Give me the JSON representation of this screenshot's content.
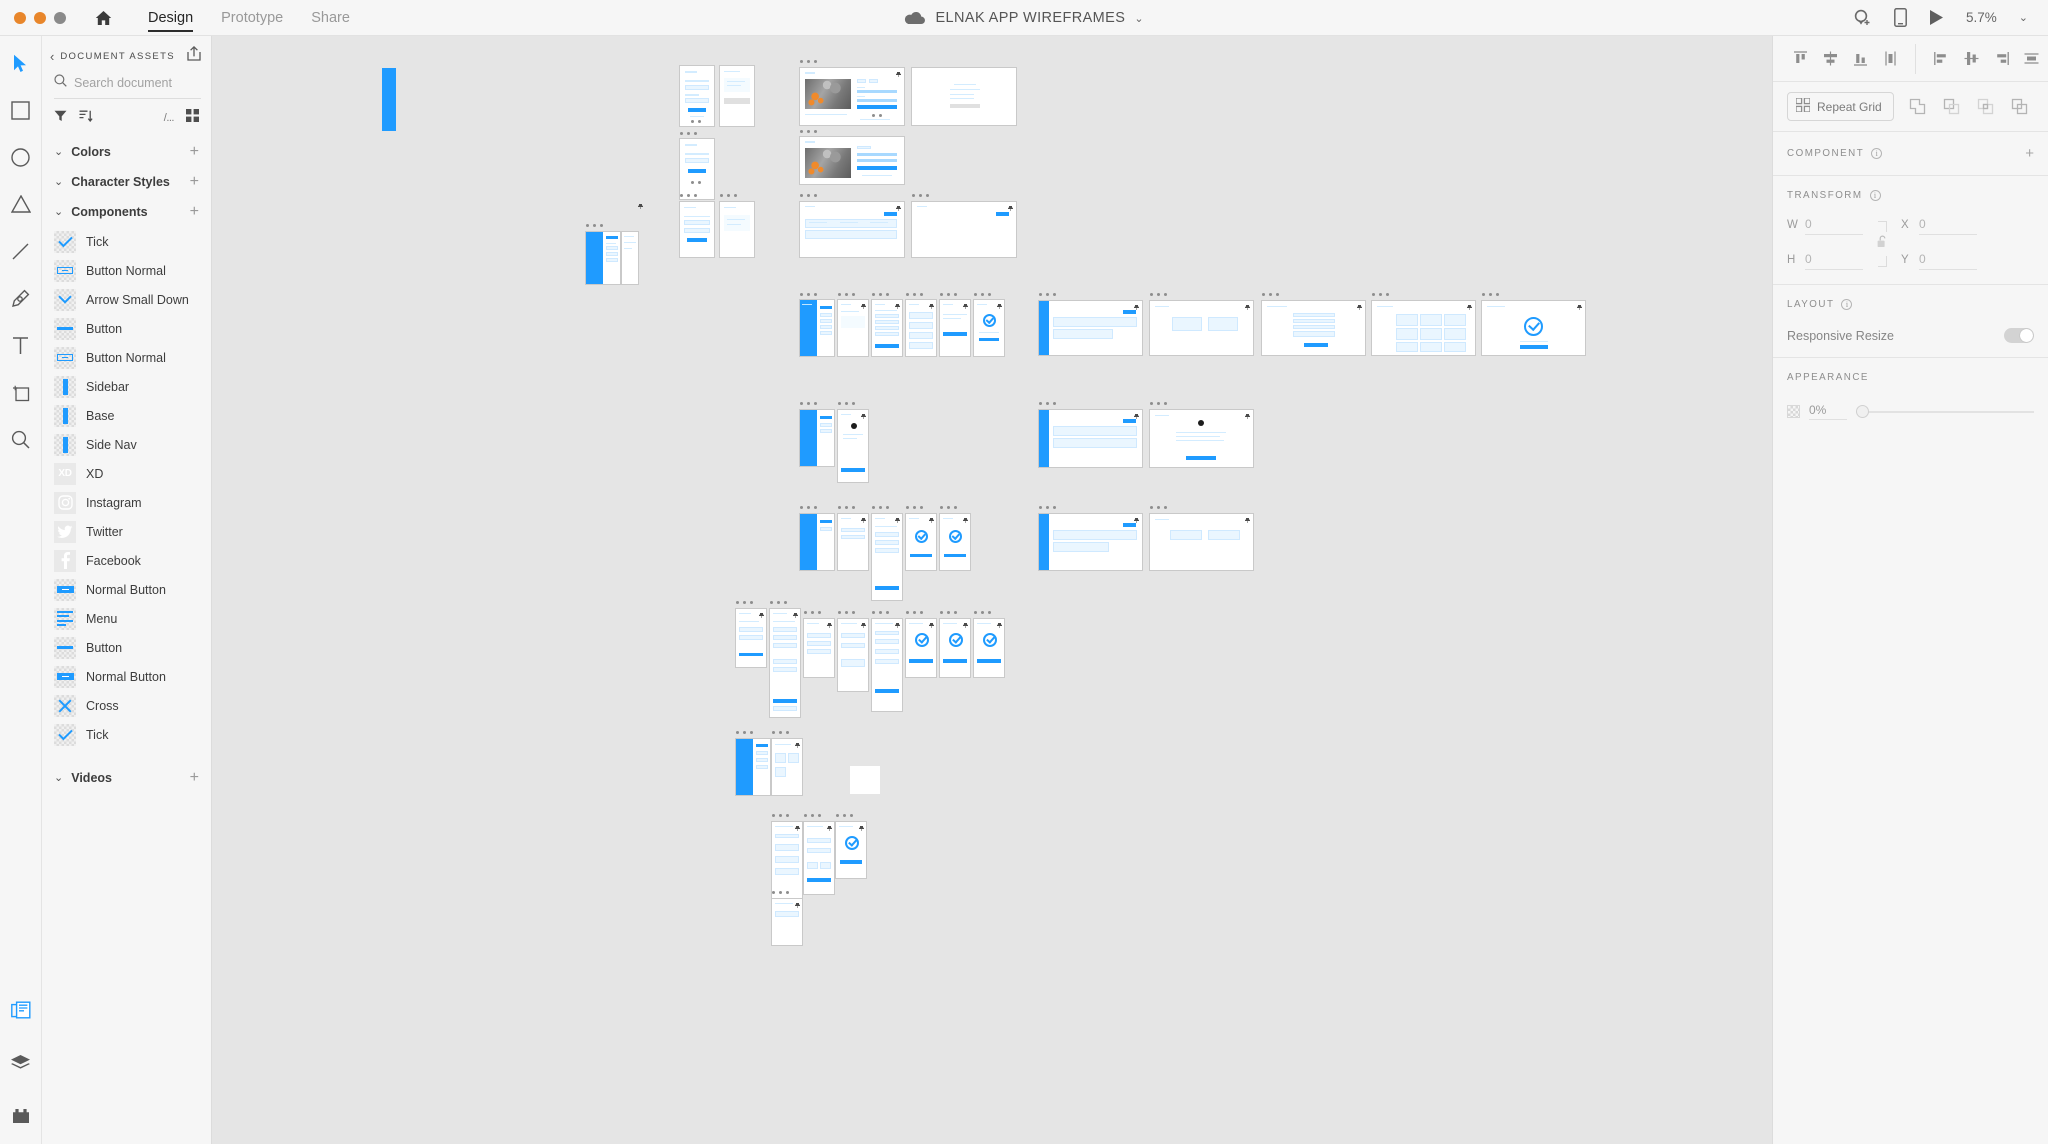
{
  "titlebar": {
    "window_controls": [
      "close",
      "minimize",
      "maximize"
    ],
    "home_icon": "home-icon",
    "tabs": [
      {
        "label": "Design",
        "active": true
      },
      {
        "label": "Prototype",
        "active": false
      },
      {
        "label": "Share",
        "active": false
      }
    ],
    "document_title": "ELNAK APP WIREFRAMES",
    "document_chevron": "⌄",
    "cloud_icon": "cloud-icon",
    "right_icons": [
      "add-collaborator-icon",
      "device-preview-icon",
      "play-preview-icon"
    ],
    "zoom_level": "5.7%",
    "zoom_chevron": "⌄"
  },
  "toolbar": {
    "tools": [
      {
        "name": "select-tool",
        "active": true
      },
      {
        "name": "rectangle-tool",
        "active": false
      },
      {
        "name": "ellipse-tool",
        "active": false
      },
      {
        "name": "polygon-tool",
        "active": false
      },
      {
        "name": "line-tool",
        "active": false
      },
      {
        "name": "pen-tool",
        "active": false
      },
      {
        "name": "text-tool",
        "active": false
      },
      {
        "name": "artboard-tool",
        "active": false
      },
      {
        "name": "zoom-tool",
        "active": false
      }
    ],
    "bottom_tools": [
      {
        "name": "assets-panel-toggle",
        "active": true
      },
      {
        "name": "layers-panel-toggle",
        "active": false
      },
      {
        "name": "plugins-panel-toggle",
        "active": false
      }
    ]
  },
  "assets_panel": {
    "back_chevron": "‹",
    "title": "DOCUMENT ASSETS",
    "publish_icon": "publish-share-icon",
    "search": {
      "placeholder": "Search document",
      "value": ""
    },
    "search_icon": "search-icon",
    "search_chevron": "⌄",
    "filter_icon": "filter-icon",
    "sort_icon": "sort-icon",
    "slash_label": "/...",
    "grid_icon": "grid-view-icon",
    "groups": [
      {
        "label": "Colors",
        "chevron": "⌄",
        "plus": "+",
        "items": []
      },
      {
        "label": "Character Styles",
        "chevron": "⌄",
        "plus": "+",
        "items": []
      },
      {
        "label": "Components",
        "chevron": "⌄",
        "plus": "+",
        "items": [
          {
            "label": "Tick",
            "thumb": "tick-check"
          },
          {
            "label": "Button Normal",
            "thumb": "button-outline"
          },
          {
            "label": "Arrow Small Down",
            "thumb": "arrow-down"
          },
          {
            "label": "Button",
            "thumb": "button-bar"
          },
          {
            "label": "Button Normal",
            "thumb": "button-outline"
          },
          {
            "label": "Sidebar",
            "thumb": "bar-vertical"
          },
          {
            "label": "Base",
            "thumb": "bar-vertical"
          },
          {
            "label": "Side Nav",
            "thumb": "bar-vertical"
          },
          {
            "label": "XD",
            "thumb": "xd-logo"
          },
          {
            "label": "Instagram",
            "thumb": "instagram-logo"
          },
          {
            "label": "Twitter",
            "thumb": "twitter-logo"
          },
          {
            "label": "Facebook",
            "thumb": "facebook-logo"
          },
          {
            "label": "Normal Button",
            "thumb": "button-filled"
          },
          {
            "label": "Menu",
            "thumb": "menu-lines"
          },
          {
            "label": "Button",
            "thumb": "button-bar"
          },
          {
            "label": "Normal Button",
            "thumb": "button-filled"
          },
          {
            "label": "Cross",
            "thumb": "cross-x"
          },
          {
            "label": "Tick",
            "thumb": "tick-check"
          }
        ]
      },
      {
        "label": "Videos",
        "chevron": "⌄",
        "plus": "+",
        "items": []
      }
    ]
  },
  "properties_panel": {
    "align_buttons": [
      "align-top-icon",
      "align-vertical-center-icon",
      "align-bottom-icon",
      "align-middle-icon",
      "align-left-icon",
      "align-horizontal-center-icon",
      "align-right-icon",
      "distribute-icon"
    ],
    "repeat_grid": {
      "label": "Repeat Grid",
      "icon": "repeat-grid-icon"
    },
    "boolean_ops": [
      "add-shape-icon",
      "subtract-shape-icon",
      "intersect-shape-icon",
      "exclude-overlap-icon"
    ],
    "component_section": {
      "title": "COMPONENT",
      "info": "i",
      "plus": "+"
    },
    "transform_section": {
      "title": "TRANSFORM",
      "info": "i",
      "lock_icon": "lock-open-icon",
      "fields": [
        {
          "label": "W",
          "value": "0"
        },
        {
          "label": "X",
          "value": "0"
        },
        {
          "label": "H",
          "value": "0"
        },
        {
          "label": "Y",
          "value": "0"
        }
      ]
    },
    "layout_section": {
      "title": "LAYOUT",
      "info": "i",
      "responsive_resize_label": "Responsive Resize",
      "responsive_resize_on": false
    },
    "appearance_section": {
      "title": "APPEARANCE",
      "opacity_value": "0%",
      "opacity_icon": "opacity-checker-icon"
    }
  },
  "canvas": {
    "accent_color": "#1f9bff",
    "background": "#e5e5e5",
    "artboard_fill": "#ffffff",
    "artboard_count": 52,
    "zoom": "5.7%"
  }
}
